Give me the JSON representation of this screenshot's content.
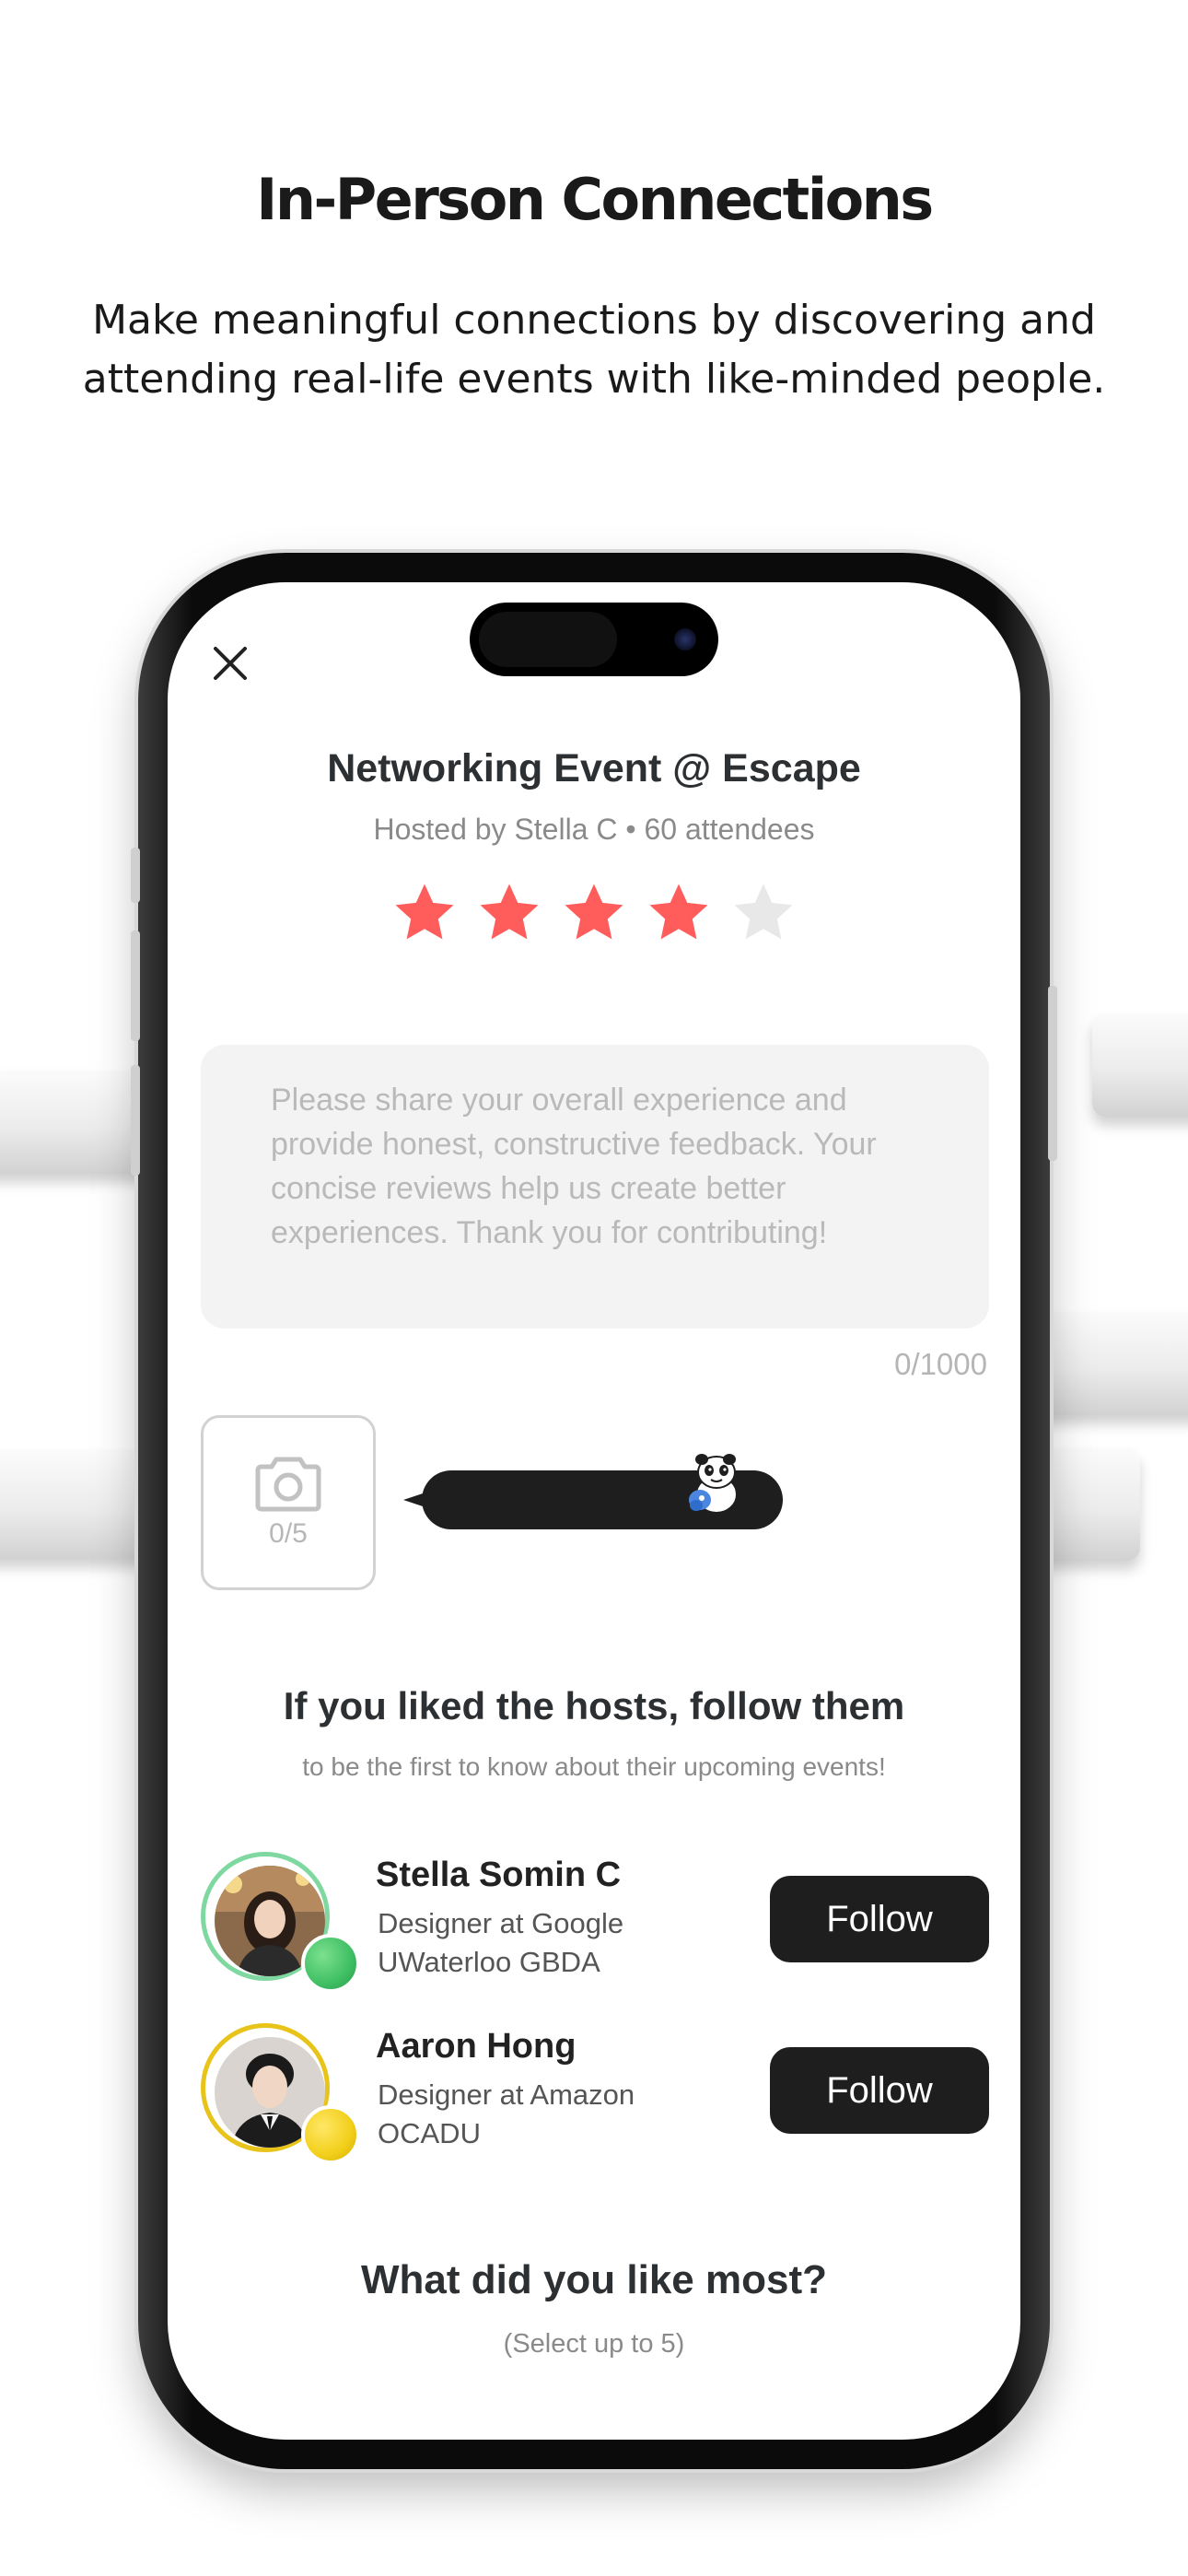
{
  "marketing": {
    "headline": "In-Person Connections",
    "subtext_line1": "Make meaningful connections by discovering and",
    "subtext_line2": "attending real-life events with like-minded people."
  },
  "event": {
    "title": "Networking Event @ Escape",
    "meta": "Hosted by Stella C • 60 attendees"
  },
  "rating": {
    "value": 4,
    "max": 5,
    "filled_color": "#ff5c5c",
    "empty_color": "#e8e8e8"
  },
  "review": {
    "placeholder": "Please share your overall experience and provide honest, constructive feedback. Your concise reviews help us create better experiences. Thank you for contributing!",
    "value": "",
    "char_count": "0/1000"
  },
  "photos": {
    "count_label": "0/5",
    "icon": "camera-icon"
  },
  "hosts_section": {
    "title": "If you liked the hosts, follow them",
    "subtitle": "to be the first to know about their upcoming events!",
    "hosts": [
      {
        "name": "Stella Somin C",
        "line1": "Designer at Google",
        "line2": "UWaterloo GBDA",
        "follow_label": "Follow",
        "ring_color": "#7ed8a0",
        "badge_color": "#3fbf64"
      },
      {
        "name": "Aaron Hong",
        "line1": "Designer at Amazon",
        "line2": "OCADU",
        "follow_label": "Follow",
        "ring_color": "#e8c41a",
        "badge_color": "#f2cf1a"
      }
    ]
  },
  "liked_section": {
    "title": "What did you like most?",
    "subtitle": "(Select up to 5)"
  },
  "colors": {
    "primary_dark": "#1e1e1e",
    "text_muted": "#8a8a8a"
  }
}
